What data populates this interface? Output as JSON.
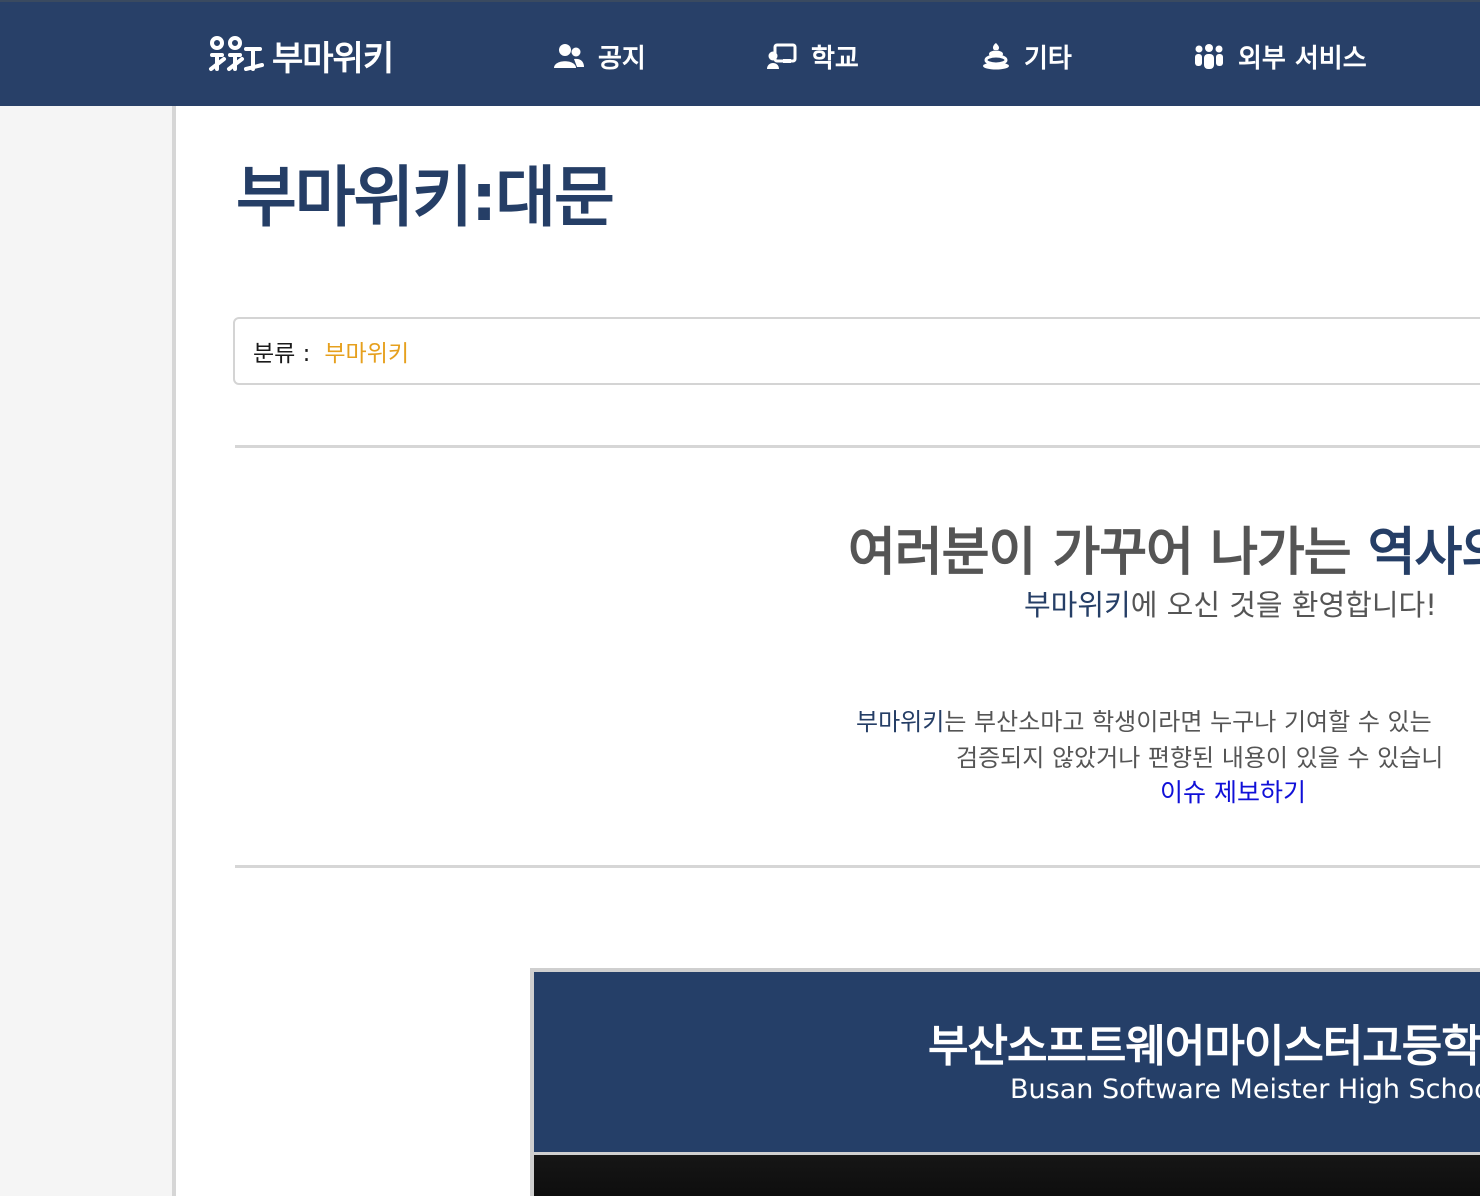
{
  "header": {
    "logo_text": "부마위키",
    "nav": [
      {
        "label": "공지",
        "icon": "users-icon"
      },
      {
        "label": "학교",
        "icon": "chalkboard-teacher-icon"
      },
      {
        "label": "기타",
        "icon": "poop-icon"
      },
      {
        "label": "외부 서비스",
        "icon": "people-group-icon"
      }
    ]
  },
  "page": {
    "title": "부마위키:대문",
    "category_label": "분류 :",
    "category_value": "부마위키"
  },
  "welcome": {
    "headline_prefix": "여러분이 가꾸어 나가는 ",
    "headline_accent": "역사의",
    "sub_accent": "부마위키",
    "sub_rest": "에 오신 것을 환영합니다!",
    "desc_line1_accent": "부마위키",
    "desc_line1_rest": "는 부산소마고 학생이라면 누구나 기여할 수 있는",
    "desc_line2": "검증되지 않았거나 편향된 내용이 있을 수 있습니",
    "issue_link": "이슈 제보하기"
  },
  "banner": {
    "title": "부산소프트웨어마이스터고등학",
    "subtitle": "Busan Software Meister High School"
  },
  "colors": {
    "header_bg": "#284068",
    "accent": "#253e66",
    "category_link": "#e6a01e",
    "issue_link": "#1010d8"
  }
}
